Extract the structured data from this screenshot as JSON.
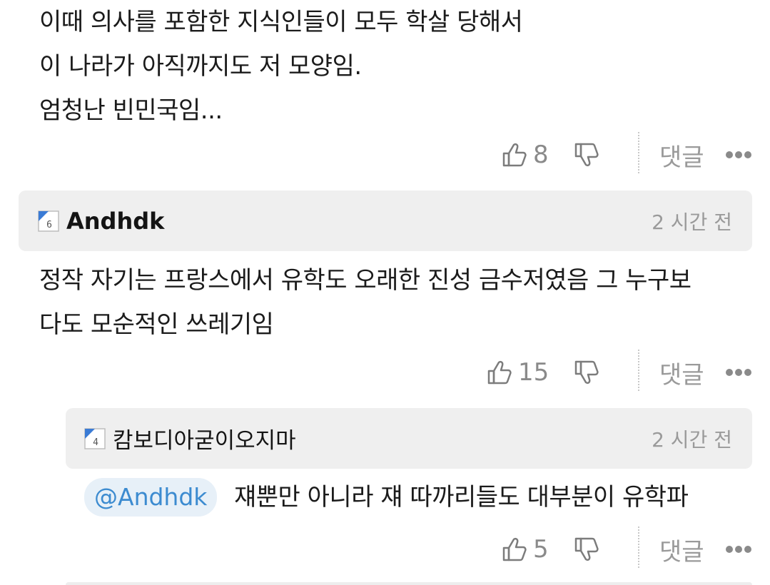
{
  "comment1": {
    "lines": [
      "이때 의사를 포함한 지식인들이 모두 학살 당해서",
      "이 나라가 아직까지도 저 모양임.",
      "엄청난 빈민국임..."
    ],
    "likes": "8",
    "reply_label": "댓글"
  },
  "comment2": {
    "level": "6",
    "author": "Andhdk",
    "time": "2 시간 전",
    "lines": [
      "정작 자기는 프랑스에서 유학도 오래한 진성 금수저였음 그 누구보",
      "다도 모순적인 쓰레기임"
    ],
    "likes": "15",
    "reply_label": "댓글"
  },
  "comment3": {
    "level": "4",
    "author": "캄보디아굳이오지마",
    "time": "2 시간 전",
    "mention": "@Andhdk",
    "text": "쟤뿐만 아니라 쟤 따까리들도 대부분이 유학파",
    "likes": "5",
    "reply_label": "댓글"
  },
  "icons": {
    "like": "thumbs-up-outline-icon",
    "dislike": "thumbs-down-outline-icon",
    "more": "more-dots-icon",
    "level_badge": "level-badge-icon"
  },
  "colors": {
    "mention_text": "#3c8bd0",
    "mention_bg": "#e7f0f8",
    "header_bg": "#efefef",
    "badge_blue": "#3a7bd5"
  }
}
